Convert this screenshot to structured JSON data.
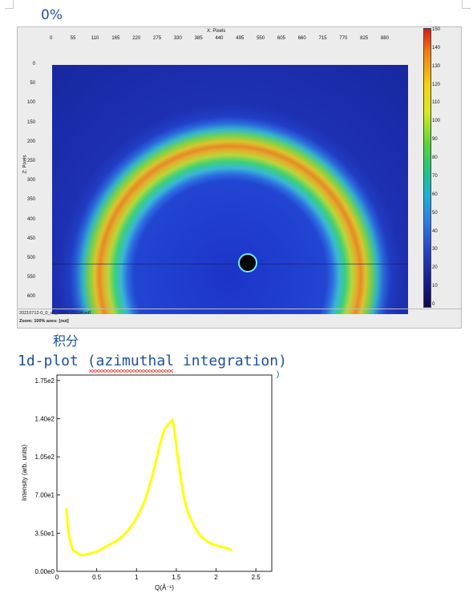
{
  "page": {
    "percent_text": "0%",
    "heading_cn": "积分",
    "heading_plot": "1d-plot (azimuthal integration)",
    "tail_mark": ")"
  },
  "detector_view": {
    "x_axis_title": "X: Pixels",
    "z_axis_title": "Z: Pixels",
    "x_ticks": [
      "0",
      "55",
      "110",
      "165",
      "220",
      "275",
      "330",
      "385",
      "440",
      "495",
      "550",
      "605",
      "660",
      "715",
      "770",
      "825",
      "880"
    ],
    "z_ticks": [
      "0",
      "50",
      "100",
      "150",
      "200",
      "250",
      "300",
      "350",
      "400",
      "450",
      "500",
      "550",
      "600"
    ],
    "colorbar_ticks": [
      "150",
      "140",
      "130",
      "120",
      "110",
      "100",
      "90",
      "80",
      "70",
      "60",
      "50",
      "40",
      "30",
      "20",
      "10",
      "0"
    ],
    "filename": "20210712-0_0_x6_00001-00004.edf",
    "zoom_status": "Zoom: 100%   axes: [out]"
  },
  "chart_data": {
    "type": "line",
    "title": "",
    "xlabel": "Q(Å⁻¹)",
    "ylabel": "Intensity (arb. units)",
    "xlim": [
      0,
      2.7
    ],
    "ylim": [
      0,
      180
    ],
    "x_ticks": [
      "0",
      "0.5",
      "1",
      "1.5",
      "2",
      "2.5"
    ],
    "y_ticks": [
      "0.00e0",
      "3.50e1",
      "7.00e1",
      "1.05e2",
      "1.40e2",
      "1.75e2"
    ],
    "x_tick_values": [
      0,
      0.5,
      1,
      1.5,
      2,
      2.5
    ],
    "y_tick_values": [
      0,
      35,
      70,
      105,
      140,
      175
    ],
    "line_color": "#ffff00",
    "series": [
      {
        "x": [
          0.12,
          0.14,
          0.17,
          0.2,
          0.25,
          0.3,
          0.35,
          0.4,
          0.45,
          0.5,
          0.55,
          0.6,
          0.65,
          0.7,
          0.75,
          0.8,
          0.85,
          0.9,
          0.95,
          1.0,
          1.05,
          1.1,
          1.15,
          1.2,
          1.25,
          1.3,
          1.35,
          1.4,
          1.42,
          1.45,
          1.48,
          1.5,
          1.55,
          1.6,
          1.65,
          1.7,
          1.75,
          1.8,
          1.85,
          1.9,
          1.95,
          2.0,
          2.05,
          2.1,
          2.15,
          2.2
        ],
        "y": [
          58,
          38,
          26,
          20,
          17,
          15,
          15,
          16,
          17,
          18,
          20,
          22,
          24,
          26,
          28,
          31,
          34,
          38,
          43,
          49,
          56,
          64,
          75,
          88,
          103,
          118,
          130,
          135,
          136,
          139,
          128,
          115,
          88,
          66,
          53,
          45,
          38,
          33,
          30,
          27,
          25,
          24,
          23,
          22,
          21,
          19
        ]
      }
    ]
  }
}
